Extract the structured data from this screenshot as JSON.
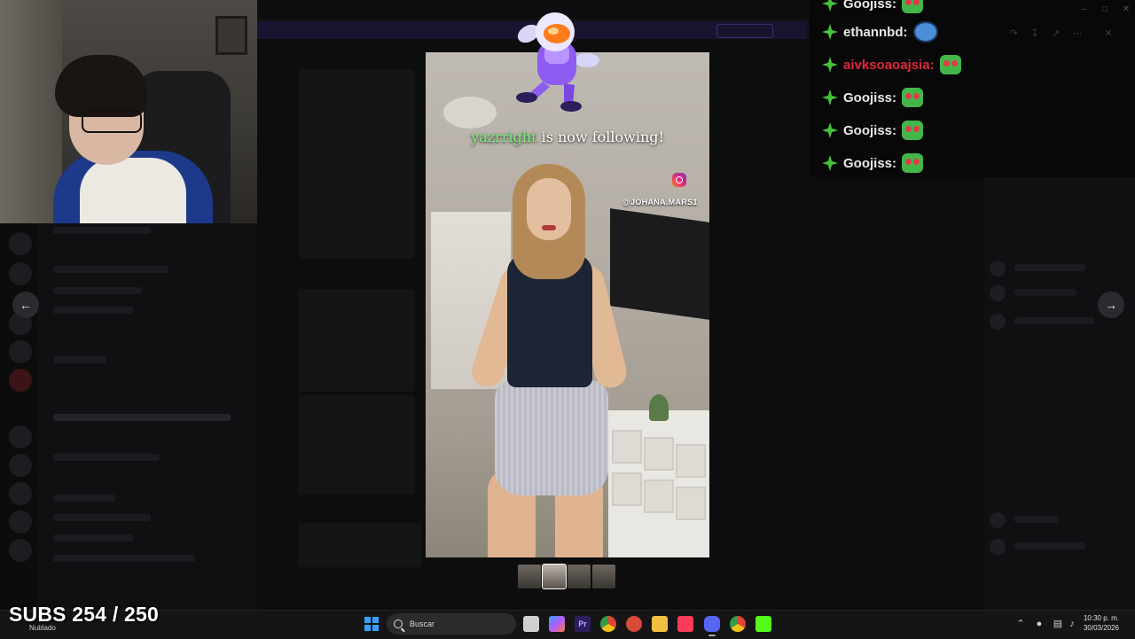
{
  "overlay": {
    "follow_user": "yazrright",
    "follow_text": " is now following!",
    "subs_label": "SUBS 254 / 250"
  },
  "video": {
    "handle": "@JOHANA.MARS1"
  },
  "chat": {
    "messages": [
      {
        "user": "Goojiss:",
        "color": "#e8e8e8",
        "emote": "heart-eyes-emote"
      },
      {
        "user": "ethannbd:",
        "color": "#e8e8e8",
        "emote": "blue-face-emote"
      },
      {
        "user": "aivksoaoajsia:",
        "color": "#e0283c",
        "emote": "heart-eyes-emote"
      },
      {
        "user": "Goojiss:",
        "color": "#e8e8e8",
        "emote": "heart-eyes-emote"
      },
      {
        "user": "Goojiss:",
        "color": "#e8e8e8",
        "emote": "heart-eyes-emote"
      },
      {
        "user": "Goojiss:",
        "color": "#e8e8e8",
        "emote": "heart-eyes-emote"
      }
    ]
  },
  "taskbar": {
    "weather": "Nublado",
    "search_label": "Buscar",
    "time": "10:30 p. m.",
    "date": "30/03/2026",
    "apps": [
      {
        "name": "task-view-icon",
        "color": "#cfcfcf"
      },
      {
        "name": "copilot-icon",
        "color": "#7b6cff"
      },
      {
        "name": "premiere-icon",
        "color": "#2c1e5c"
      },
      {
        "name": "chrome-icon",
        "color": "#e0a228"
      },
      {
        "name": "app-red-icon",
        "color": "#d84a3a"
      },
      {
        "name": "file-explorer-icon",
        "color": "#f0c040"
      },
      {
        "name": "music-app-icon",
        "color": "#fa3c5a"
      },
      {
        "name": "discord-icon",
        "color": "#5865f2"
      },
      {
        "name": "chrome-profile-icon",
        "color": "#36a852"
      },
      {
        "name": "kick-icon",
        "color": "#53fc18"
      }
    ]
  }
}
